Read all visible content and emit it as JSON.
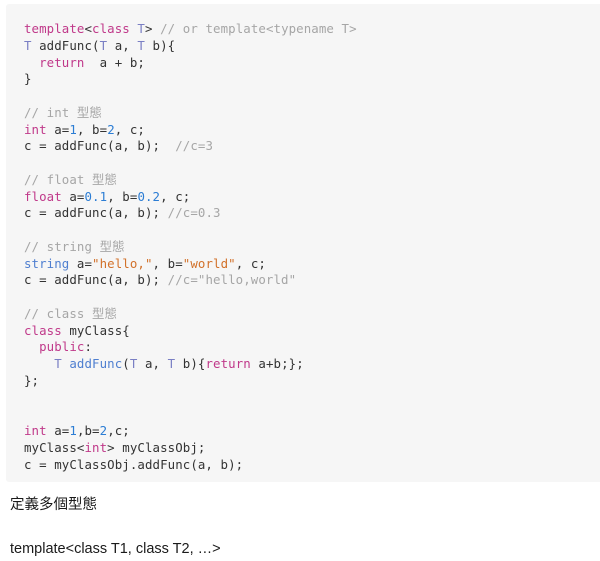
{
  "code_block": {
    "language": "cpp",
    "background": "#f6f6f6",
    "colors": {
      "keyword": "#c0398a",
      "type_param": "#7a7fc4",
      "function": "#4f7fd0",
      "number": "#2c7dd4",
      "string": "#d2712a",
      "comment": "#a6a6a6",
      "plain": "#333333"
    },
    "lines": [
      {
        "tokens": [
          {
            "t": "template",
            "c": "kw"
          },
          {
            "t": "<",
            "c": "pln"
          },
          {
            "t": "class",
            "c": "kw"
          },
          {
            "t": " ",
            "c": "pln"
          },
          {
            "t": "T",
            "c": "typ"
          },
          {
            "t": "> ",
            "c": "pln"
          },
          {
            "t": "// or template<typename T>",
            "c": "cmt"
          }
        ]
      },
      {
        "tokens": [
          {
            "t": "T",
            "c": "typ"
          },
          {
            "t": " addFunc(",
            "c": "pln"
          },
          {
            "t": "T",
            "c": "typ"
          },
          {
            "t": " a, ",
            "c": "pln"
          },
          {
            "t": "T",
            "c": "typ"
          },
          {
            "t": " b){",
            "c": "pln"
          }
        ]
      },
      {
        "tokens": [
          {
            "t": "  ",
            "c": "pln"
          },
          {
            "t": "return",
            "c": "kw"
          },
          {
            "t": "  a + b;",
            "c": "pln"
          }
        ]
      },
      {
        "tokens": [
          {
            "t": "}",
            "c": "pln"
          }
        ]
      },
      {
        "tokens": [
          {
            "t": "",
            "c": "pln"
          }
        ]
      },
      {
        "tokens": [
          {
            "t": "// int ",
            "c": "cmt"
          },
          {
            "t": "型態",
            "c": "cjk"
          }
        ]
      },
      {
        "tokens": [
          {
            "t": "int",
            "c": "kw"
          },
          {
            "t": " a=",
            "c": "pln"
          },
          {
            "t": "1",
            "c": "num"
          },
          {
            "t": ", b=",
            "c": "pln"
          },
          {
            "t": "2",
            "c": "num"
          },
          {
            "t": ", c;",
            "c": "pln"
          }
        ]
      },
      {
        "tokens": [
          {
            "t": "c = addFunc(a, b);  ",
            "c": "pln"
          },
          {
            "t": "//c=3",
            "c": "cmt"
          }
        ]
      },
      {
        "tokens": [
          {
            "t": "",
            "c": "pln"
          }
        ]
      },
      {
        "tokens": [
          {
            "t": "// float ",
            "c": "cmt"
          },
          {
            "t": "型態",
            "c": "cjk"
          }
        ]
      },
      {
        "tokens": [
          {
            "t": "float",
            "c": "kw"
          },
          {
            "t": " a=",
            "c": "pln"
          },
          {
            "t": "0.1",
            "c": "num"
          },
          {
            "t": ", b=",
            "c": "pln"
          },
          {
            "t": "0.2",
            "c": "num"
          },
          {
            "t": ", c;",
            "c": "pln"
          }
        ]
      },
      {
        "tokens": [
          {
            "t": "c = addFunc(a, b); ",
            "c": "pln"
          },
          {
            "t": "//c=0.3",
            "c": "cmt"
          }
        ]
      },
      {
        "tokens": [
          {
            "t": "",
            "c": "pln"
          }
        ]
      },
      {
        "tokens": [
          {
            "t": "// string ",
            "c": "cmt"
          },
          {
            "t": "型態",
            "c": "cjk"
          }
        ]
      },
      {
        "tokens": [
          {
            "t": "string",
            "c": "fn"
          },
          {
            "t": " a=",
            "c": "pln"
          },
          {
            "t": "\"hello,\"",
            "c": "str"
          },
          {
            "t": ", b=",
            "c": "pln"
          },
          {
            "t": "\"world\"",
            "c": "str"
          },
          {
            "t": ", c;",
            "c": "pln"
          }
        ]
      },
      {
        "tokens": [
          {
            "t": "c = addFunc(a, b); ",
            "c": "pln"
          },
          {
            "t": "//c=\"hello,world\"",
            "c": "cmt"
          }
        ]
      },
      {
        "tokens": [
          {
            "t": "",
            "c": "pln"
          }
        ]
      },
      {
        "tokens": [
          {
            "t": "// class ",
            "c": "cmt"
          },
          {
            "t": "型態",
            "c": "cjk"
          }
        ]
      },
      {
        "tokens": [
          {
            "t": "class",
            "c": "kw"
          },
          {
            "t": " myClass{",
            "c": "pln"
          }
        ]
      },
      {
        "tokens": [
          {
            "t": "  ",
            "c": "pln"
          },
          {
            "t": "public",
            "c": "kw"
          },
          {
            "t": ":",
            "c": "pln"
          }
        ]
      },
      {
        "tokens": [
          {
            "t": "    ",
            "c": "pln"
          },
          {
            "t": "T",
            "c": "typ"
          },
          {
            "t": " ",
            "c": "pln"
          },
          {
            "t": "addFunc",
            "c": "fn"
          },
          {
            "t": "(",
            "c": "pln"
          },
          {
            "t": "T",
            "c": "typ"
          },
          {
            "t": " a, ",
            "c": "pln"
          },
          {
            "t": "T",
            "c": "typ"
          },
          {
            "t": " b){",
            "c": "pln"
          },
          {
            "t": "return",
            "c": "kw"
          },
          {
            "t": " a+b;};",
            "c": "pln"
          }
        ]
      },
      {
        "tokens": [
          {
            "t": "};",
            "c": "pln"
          }
        ]
      },
      {
        "tokens": [
          {
            "t": "",
            "c": "pln"
          }
        ]
      },
      {
        "tokens": [
          {
            "t": "",
            "c": "pln"
          }
        ]
      },
      {
        "tokens": [
          {
            "t": "int",
            "c": "kw"
          },
          {
            "t": " a=",
            "c": "pln"
          },
          {
            "t": "1",
            "c": "num"
          },
          {
            "t": ",b=",
            "c": "pln"
          },
          {
            "t": "2",
            "c": "num"
          },
          {
            "t": ",c;",
            "c": "pln"
          }
        ]
      },
      {
        "tokens": [
          {
            "t": "myClass<",
            "c": "pln"
          },
          {
            "t": "int",
            "c": "kw"
          },
          {
            "t": "> myClassObj;",
            "c": "pln"
          }
        ]
      },
      {
        "tokens": [
          {
            "t": "c = myClassObj.addFunc(a, b);",
            "c": "pln"
          }
        ]
      }
    ]
  },
  "prose": {
    "heading": "定義多個型態",
    "snippet": "template<class T1, class T2, …>"
  }
}
